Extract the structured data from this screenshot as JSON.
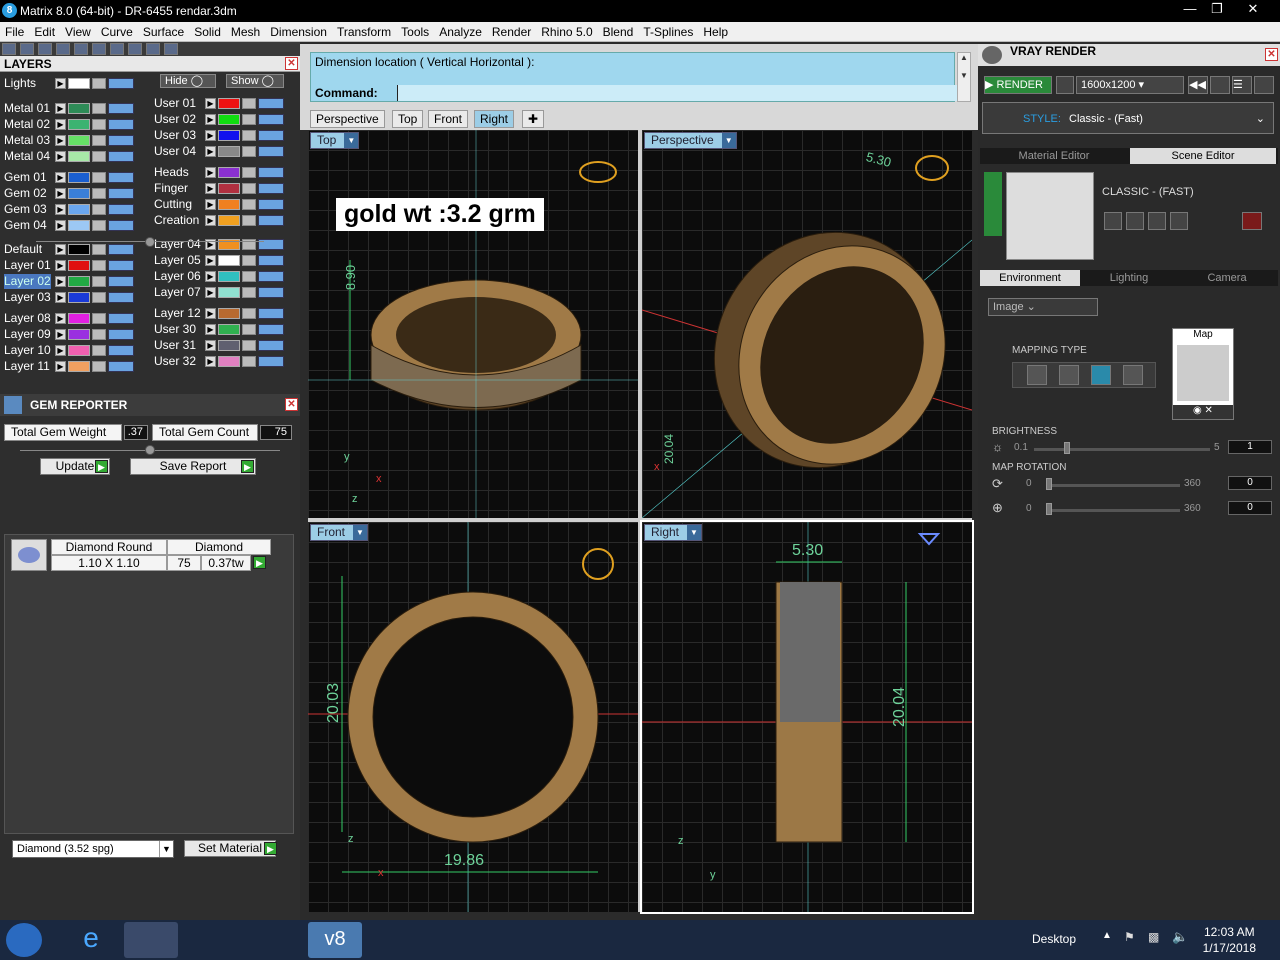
{
  "window": {
    "title": "Matrix 8.0 (64-bit) - DR-6455 rendar.3dm",
    "app_icon_label": "8"
  },
  "menu": [
    "File",
    "Edit",
    "View",
    "Curve",
    "Surface",
    "Solid",
    "Mesh",
    "Dimension",
    "Transform",
    "Tools",
    "Analyze",
    "Render",
    "Rhino 5.0",
    "Blend",
    "T-Splines",
    "Help"
  ],
  "layers_panel": {
    "title": "LAYERS",
    "hide_label": "Hide",
    "show_label": "Show",
    "left": [
      {
        "name": "Lights",
        "color": "#ffffff"
      },
      {
        "name": "Metal 01",
        "color": "#2e8b57"
      },
      {
        "name": "Metal 02",
        "color": "#3cb371"
      },
      {
        "name": "Metal 03",
        "color": "#66e066"
      },
      {
        "name": "Metal 04",
        "color": "#a8e8a8"
      },
      {
        "name": "Gem 01",
        "color": "#1a5fd0"
      },
      {
        "name": "Gem 02",
        "color": "#3a7fd8"
      },
      {
        "name": "Gem 03",
        "color": "#6aa6ee"
      },
      {
        "name": "Gem 04",
        "color": "#9cc8f4"
      },
      {
        "name": "Default",
        "color": "#000000"
      },
      {
        "name": "Layer 01",
        "color": "#e01010"
      },
      {
        "name": "Layer 02",
        "color": "#22aa44"
      },
      {
        "name": "Layer 03",
        "color": "#1a3ad8"
      },
      {
        "name": "Layer 08",
        "color": "#e020e0"
      },
      {
        "name": "Layer 09",
        "color": "#9a30e0"
      },
      {
        "name": "Layer 10",
        "color": "#f060b0"
      },
      {
        "name": "Layer 11",
        "color": "#f0a060"
      }
    ],
    "right": [
      {
        "name": "User 01",
        "color": "#ee1111"
      },
      {
        "name": "User 02",
        "color": "#11dd11"
      },
      {
        "name": "User 03",
        "color": "#1111ee"
      },
      {
        "name": "User 04",
        "color": "#888888"
      },
      {
        "name": "Heads",
        "color": "#8a30d0"
      },
      {
        "name": "Finger",
        "color": "#b03040"
      },
      {
        "name": "Cutting",
        "color": "#f08020"
      },
      {
        "name": "Creation",
        "color": "#f0a020"
      },
      {
        "name": "Layer 04",
        "color": "#f09020"
      },
      {
        "name": "Layer 05",
        "color": "#ffffff"
      },
      {
        "name": "Layer 06",
        "color": "#30c0c0"
      },
      {
        "name": "Layer 07",
        "color": "#90e0d0"
      },
      {
        "name": "Layer 12",
        "color": "#b86a30"
      },
      {
        "name": "User 30",
        "color": "#30b050"
      },
      {
        "name": "User 31",
        "color": "#606070"
      },
      {
        "name": "User 32",
        "color": "#e080c0"
      }
    ],
    "selected": "Layer 02"
  },
  "gem_reporter": {
    "title": "GEM REPORTER",
    "total_weight_label": "Total Gem Weight",
    "total_weight": ".37",
    "total_count_label": "Total Gem Count",
    "total_count": "75",
    "update_label": "Update",
    "save_report_label": "Save Report",
    "row": {
      "shape": "Diamond Round",
      "size": "1.10 X 1.10",
      "type": "Diamond",
      "count": "75",
      "weight": "0.37tw"
    },
    "material": "Diamond     (3.52 spg)",
    "set_material_label": "Set Material"
  },
  "command": {
    "line1": "Dimension location ( Vertical  Horizontal ):",
    "prompt": "Command:"
  },
  "viewport_tabs": [
    "Perspective",
    "Top",
    "Front",
    "Right"
  ],
  "active_tab": "Right",
  "viewports": {
    "top": {
      "label": "Top",
      "note": "gold wt :3.2 grm",
      "dim": "8.90"
    },
    "perspective": {
      "label": "Perspective",
      "dim": "5.30",
      "dim2": "20.04"
    },
    "front": {
      "label": "Front",
      "dim_w": "19.86",
      "dim_h": "20.03"
    },
    "right": {
      "label": "Right",
      "dim_w": "5.30",
      "dim_h": "20.04"
    }
  },
  "vray": {
    "title": "VRAY RENDER",
    "render_label": "RENDER",
    "resolution": "1600x1200",
    "style_label": "STYLE:",
    "style_value": "Classic - (Fast)",
    "tabs": [
      "Material Editor",
      "Scene Editor"
    ],
    "active_tab": "Scene Editor",
    "scene_name": "CLASSIC - (FAST)",
    "env_tabs": [
      "Environment",
      "Lighting",
      "Camera"
    ],
    "env_active": "Environment",
    "env_type": "Image",
    "map_label": "Map",
    "mapping_type_label": "MAPPING TYPE",
    "brightness_label": "BRIGHTNESS",
    "brightness_min": "0.1",
    "brightness_max": "5",
    "brightness_value": "1",
    "rotation_label": "MAP ROTATION",
    "rot_min": "0",
    "rot_max": "360",
    "rot1_value": "0",
    "rot2_value": "0",
    "accent": "#2a9de0"
  },
  "taskbar": {
    "desktop_label": "Desktop",
    "time": "12:03 AM",
    "date": "1/17/2018"
  }
}
